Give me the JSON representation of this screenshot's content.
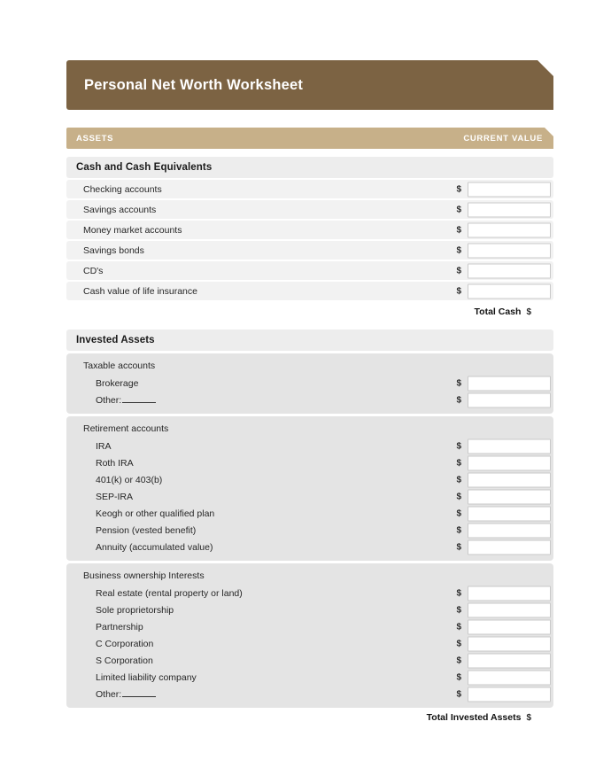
{
  "document": {
    "title": "Personal Net Worth Worksheet"
  },
  "column_header": {
    "left": "ASSETS",
    "right": "CURRENT VALUE"
  },
  "colors": {
    "title_bar": "#7c6343",
    "column_header_bar": "#c7b089",
    "section_band": "#ededed",
    "row_stripe": "#f2f2f2",
    "group_card": "#e4e4e4",
    "input_border": "#c9c9c9",
    "page_background": "#ffffff"
  },
  "currency_symbol": "$",
  "sections": [
    {
      "heading": "Cash and Cash Equivalents",
      "rows": [
        {
          "label": "Checking accounts",
          "value": ""
        },
        {
          "label": "Savings accounts",
          "value": ""
        },
        {
          "label": "Money market accounts",
          "value": ""
        },
        {
          "label": "Savings bonds",
          "value": ""
        },
        {
          "label": "CD's",
          "value": ""
        },
        {
          "label": "Cash value of life insurance",
          "value": ""
        }
      ],
      "total": {
        "label": "Total Cash",
        "value": ""
      }
    },
    {
      "heading": "Invested Assets",
      "groups": [
        {
          "title": "Taxable accounts",
          "rows": [
            {
              "label": "Brokerage",
              "value": "",
              "blank_line": false
            },
            {
              "label": "Other:",
              "value": "",
              "blank_line": true
            }
          ]
        },
        {
          "title": "Retirement accounts",
          "rows": [
            {
              "label": "IRA",
              "value": "",
              "blank_line": false
            },
            {
              "label": "Roth IRA",
              "value": "",
              "blank_line": false
            },
            {
              "label": "401(k) or 403(b)",
              "value": "",
              "blank_line": false
            },
            {
              "label": "SEP-IRA",
              "value": "",
              "blank_line": false
            },
            {
              "label": "Keogh or other qualified plan",
              "value": "",
              "blank_line": false
            },
            {
              "label": "Pension (vested benefit)",
              "value": "",
              "blank_line": false
            },
            {
              "label": "Annuity (accumulated value)",
              "value": "",
              "blank_line": false
            }
          ]
        },
        {
          "title": "Business ownership Interests",
          "rows": [
            {
              "label": "Real estate (rental property or land)",
              "value": "",
              "blank_line": false
            },
            {
              "label": "Sole proprietorship",
              "value": "",
              "blank_line": false
            },
            {
              "label": "Partnership",
              "value": "",
              "blank_line": false
            },
            {
              "label": "C Corporation",
              "value": "",
              "blank_line": false
            },
            {
              "label": "S Corporation",
              "value": "",
              "blank_line": false
            },
            {
              "label": "Limited liability company",
              "value": "",
              "blank_line": false
            },
            {
              "label": "Other:",
              "value": "",
              "blank_line": true
            }
          ]
        }
      ],
      "total": {
        "label": "Total Invested Assets",
        "value": ""
      }
    }
  ]
}
